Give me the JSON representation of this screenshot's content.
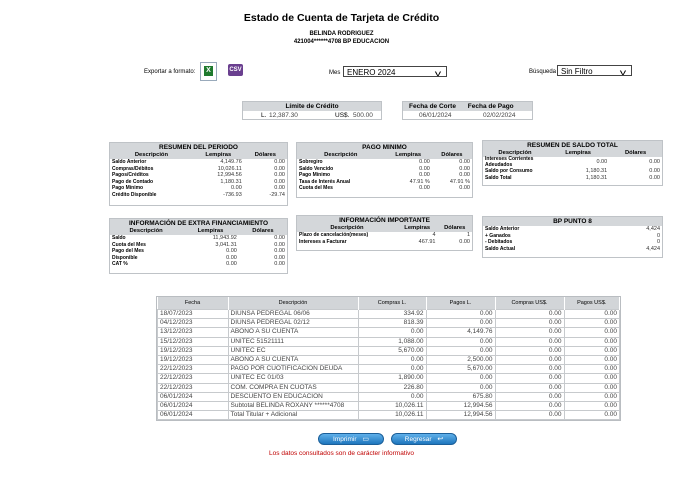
{
  "header": {
    "title": "Estado de Cuenta de Tarjeta de Crédito",
    "customer_name": "BELINDA RODRIGUEZ",
    "account_line": "421004******4708   BP EDUCACION"
  },
  "toolbar": {
    "export_label": "Exportar a formato:",
    "xls_icon_text": "X",
    "csv_icon_text": "CSV",
    "mes_label": "Mes",
    "mes_value": "ENERO 2024",
    "busqueda_label": "Búsqueda",
    "busqueda_value": "Sin Filtro"
  },
  "limite": {
    "title": "Límite de Crédito",
    "l_label": "L.",
    "l_value": "12,387.30",
    "usd_label": "US$.",
    "usd_value": "500.00"
  },
  "fechas": {
    "corte_label": "Fecha de Corte",
    "pago_label": "Fecha de Pago",
    "corte_value": "06/01/2024",
    "pago_value": "02/02/2024"
  },
  "resumen_periodo": {
    "title": "RESUMEN DEL PERIODO",
    "cols": [
      "Descripción",
      "Lempiras",
      "Dólares"
    ],
    "rows": [
      [
        "Saldo Anterior",
        "4,149.76",
        "0.00"
      ],
      [
        "Compras/Débitos",
        "10,026.11",
        "0.00"
      ],
      [
        "Pagos/Créditos",
        "12,994.56",
        "0.00"
      ],
      [
        "Pago de Contado",
        "1,180.31",
        "0.00"
      ],
      [
        "Pago Mínimo",
        "0.00",
        "0.00"
      ],
      [
        "Crédito Disponible",
        "-736.93",
        "-29.74"
      ]
    ]
  },
  "pago_minimo": {
    "title": "PAGO MINIMO",
    "cols": [
      "Descripción",
      "Lempiras",
      "Dólares"
    ],
    "rows": [
      [
        "Sobregiro",
        "0.00",
        "0.00"
      ],
      [
        "Saldo Vencido",
        "0.00",
        "0.00"
      ],
      [
        "Pago Mínimo",
        "0.00",
        "0.00"
      ],
      [
        "Tasa de Interés Anual",
        "47.91 %",
        "47.91 %"
      ],
      [
        "Cuota del Mes",
        "0.00",
        "0.00"
      ]
    ]
  },
  "saldo_total": {
    "title": "RESUMEN DE SALDO TOTAL",
    "cols": [
      "Descripción",
      "Lempiras",
      "Dólares"
    ],
    "rows": [
      [
        "Intereses Corrientes Adeudados",
        "0.00",
        "0.00"
      ],
      [
        "Saldo por Consumo",
        "1,180.31",
        "0.00"
      ],
      [
        "Saldo Total",
        "1,180.31",
        "0.00"
      ]
    ]
  },
  "extra_financiamiento": {
    "title": "INFORMACIÓN DE EXTRA FINANCIAMIENTO",
    "cols": [
      "Descripción",
      "Lempiras",
      "Dólares"
    ],
    "rows": [
      [
        "Saldo",
        "11,943.92",
        "0.00"
      ],
      [
        "Cuota del Mes",
        "3,041.31",
        "0.00"
      ],
      [
        "Pago del Mes",
        "0.00",
        "0.00"
      ],
      [
        "Disponible",
        "0.00",
        "0.00"
      ],
      [
        "CAT %",
        "0.00",
        "0.00"
      ]
    ]
  },
  "info_importante": {
    "title": "INFORMACIÓN IMPORTANTE",
    "cols": [
      "Descripción",
      "Lempiras",
      "Dólares"
    ],
    "rows": [
      [
        "Plazo de cancelación(meses)",
        "4",
        "1"
      ],
      [
        "Intereses a Facturar",
        "467.91",
        "0.00"
      ]
    ]
  },
  "bp_punto": {
    "title": "BP PUNTO 8",
    "rows": [
      [
        "Saldo Anterior",
        "4,424"
      ],
      [
        "+ Ganados",
        "0"
      ],
      [
        "- Debitados",
        "0"
      ],
      [
        "Saldo Actual",
        "4,424"
      ]
    ]
  },
  "movimientos": {
    "cols": [
      "Fecha",
      "Descripción",
      "Compras L.",
      "Pagos L.",
      "Compras US$.",
      "Pagos US$."
    ],
    "rows": [
      [
        "18/07/2023",
        "DIUNSA PEDREGAL 06/06",
        "334.92",
        "0.00",
        "0.00",
        "0.00"
      ],
      [
        "04/12/2023",
        "DIUNSA PEDREGAL 02/12",
        "818.39",
        "0.00",
        "0.00",
        "0.00"
      ],
      [
        "13/12/2023",
        "ABONO A SU CUENTA",
        "0.00",
        "4,149.76",
        "0.00",
        "0.00"
      ],
      [
        "15/12/2023",
        "UNITEC 51521111",
        "1,088.00",
        "0.00",
        "0.00",
        "0.00"
      ],
      [
        "19/12/2023",
        "UNITEC EC",
        "5,670.00",
        "0.00",
        "0.00",
        "0.00"
      ],
      [
        "19/12/2023",
        "ABONO A SU CUENTA",
        "0.00",
        "2,500.00",
        "0.00",
        "0.00"
      ],
      [
        "22/12/2023",
        "PAGO POR CUOTIFICACION DEUDA",
        "0.00",
        "5,670.00",
        "0.00",
        "0.00"
      ],
      [
        "22/12/2023",
        "UNITEC EC 01/03",
        "1,890.00",
        "0.00",
        "0.00",
        "0.00"
      ],
      [
        "22/12/2023",
        "COM. COMPRA EN CUOTAS",
        "226.80",
        "0.00",
        "0.00",
        "0.00"
      ],
      [
        "06/01/2024",
        "DESCUENTO EN EDUCACION",
        "0.00",
        "675.80",
        "0.00",
        "0.00"
      ],
      [
        "06/01/2024",
        "Subtotal BELINDA ROXANY ******4708",
        "10,026.11",
        "12,994.56",
        "0.00",
        "0.00"
      ],
      [
        "06/01/2024",
        "Total Titular + Adicional",
        "10,026.11",
        "12,994.56",
        "0.00",
        "0.00"
      ]
    ]
  },
  "buttons": {
    "imprimir": "Imprimir",
    "regresar": "Regresar"
  },
  "footer": "Los datos consultados son de carácter informativo"
}
